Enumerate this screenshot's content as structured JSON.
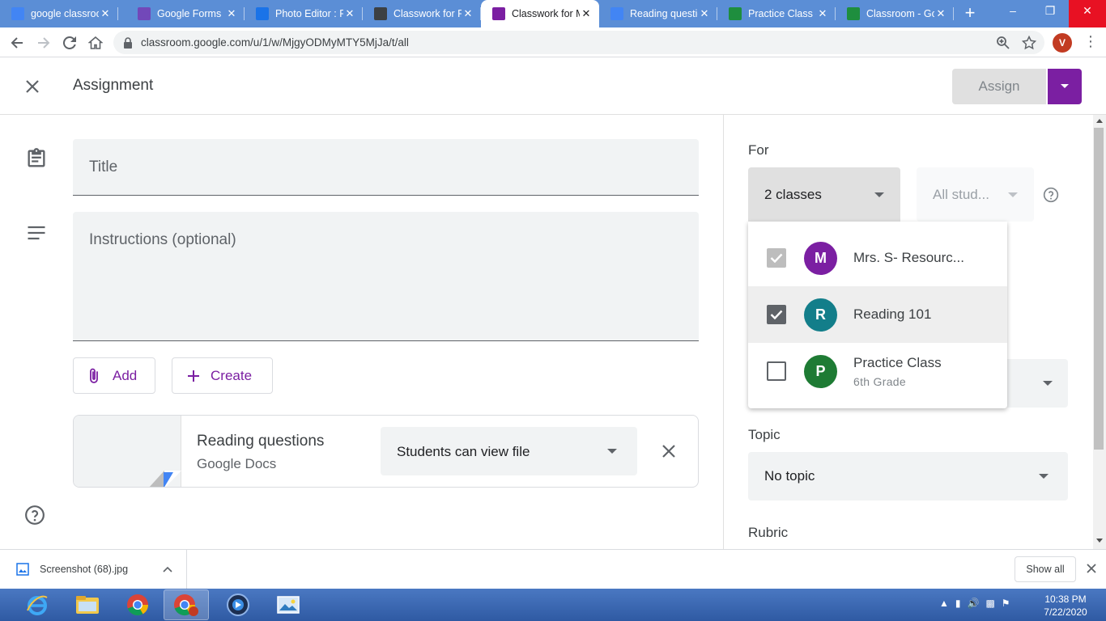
{
  "browser": {
    "tabs": [
      {
        "title": "google classroom",
        "favicon": "docs-icon",
        "color": "#4285f4"
      },
      {
        "title": "Google Forms",
        "favicon": "forms-icon",
        "color": "#7248b9"
      },
      {
        "title": "Photo Editor : P",
        "favicon": "photo-editor-icon",
        "color": "#1a73e8"
      },
      {
        "title": "Classwork for P",
        "favicon": "classroom-icon",
        "color": "#3c4043"
      },
      {
        "title": "Classwork for M",
        "favicon": "classroom-icon",
        "color": "#7b1fa2"
      },
      {
        "title": "Reading questio",
        "favicon": "docs-icon",
        "color": "#4285f4"
      },
      {
        "title": "Practice Class -",
        "favicon": "drive-icon",
        "color": "#1e8e3e"
      },
      {
        "title": "Classroom - Go",
        "favicon": "drive-icon",
        "color": "#1e8e3e"
      }
    ],
    "active_tab": 4,
    "url": "classroom.google.com/u/1/w/MjgyODMyMTY5MjJa/t/all",
    "profile_initial": "V"
  },
  "header": {
    "title": "Assignment",
    "assign_label": "Assign"
  },
  "form": {
    "title_placeholder": "Title",
    "instructions_placeholder": "Instructions (optional)",
    "add_label": "Add",
    "create_label": "Create",
    "attachment": {
      "title": "Reading questions",
      "type": "Google Docs",
      "permission": "Students can view file"
    }
  },
  "sidebar": {
    "for_label": "For",
    "classes_value": "2 classes",
    "students_value": "All stud...",
    "topic_label": "Topic",
    "topic_value": "No topic",
    "rubric_label": "Rubric",
    "class_options": [
      {
        "name": "Mrs. S- Resourc...",
        "section": "",
        "initial": "M",
        "color": "#7b1fa2",
        "checked": true,
        "disabled": true
      },
      {
        "name": "Reading 101",
        "section": "",
        "initial": "R",
        "color": "#137e8a",
        "checked": true,
        "disabled": false
      },
      {
        "name": "Practice Class",
        "section": "6th Grade",
        "initial": "P",
        "color": "#1e7b34",
        "checked": false,
        "disabled": false
      }
    ]
  },
  "downloads": {
    "file_name": "Screenshot (68).jpg",
    "show_all_label": "Show all"
  },
  "taskbar": {
    "time": "10:38 PM",
    "date": "7/22/2020"
  }
}
